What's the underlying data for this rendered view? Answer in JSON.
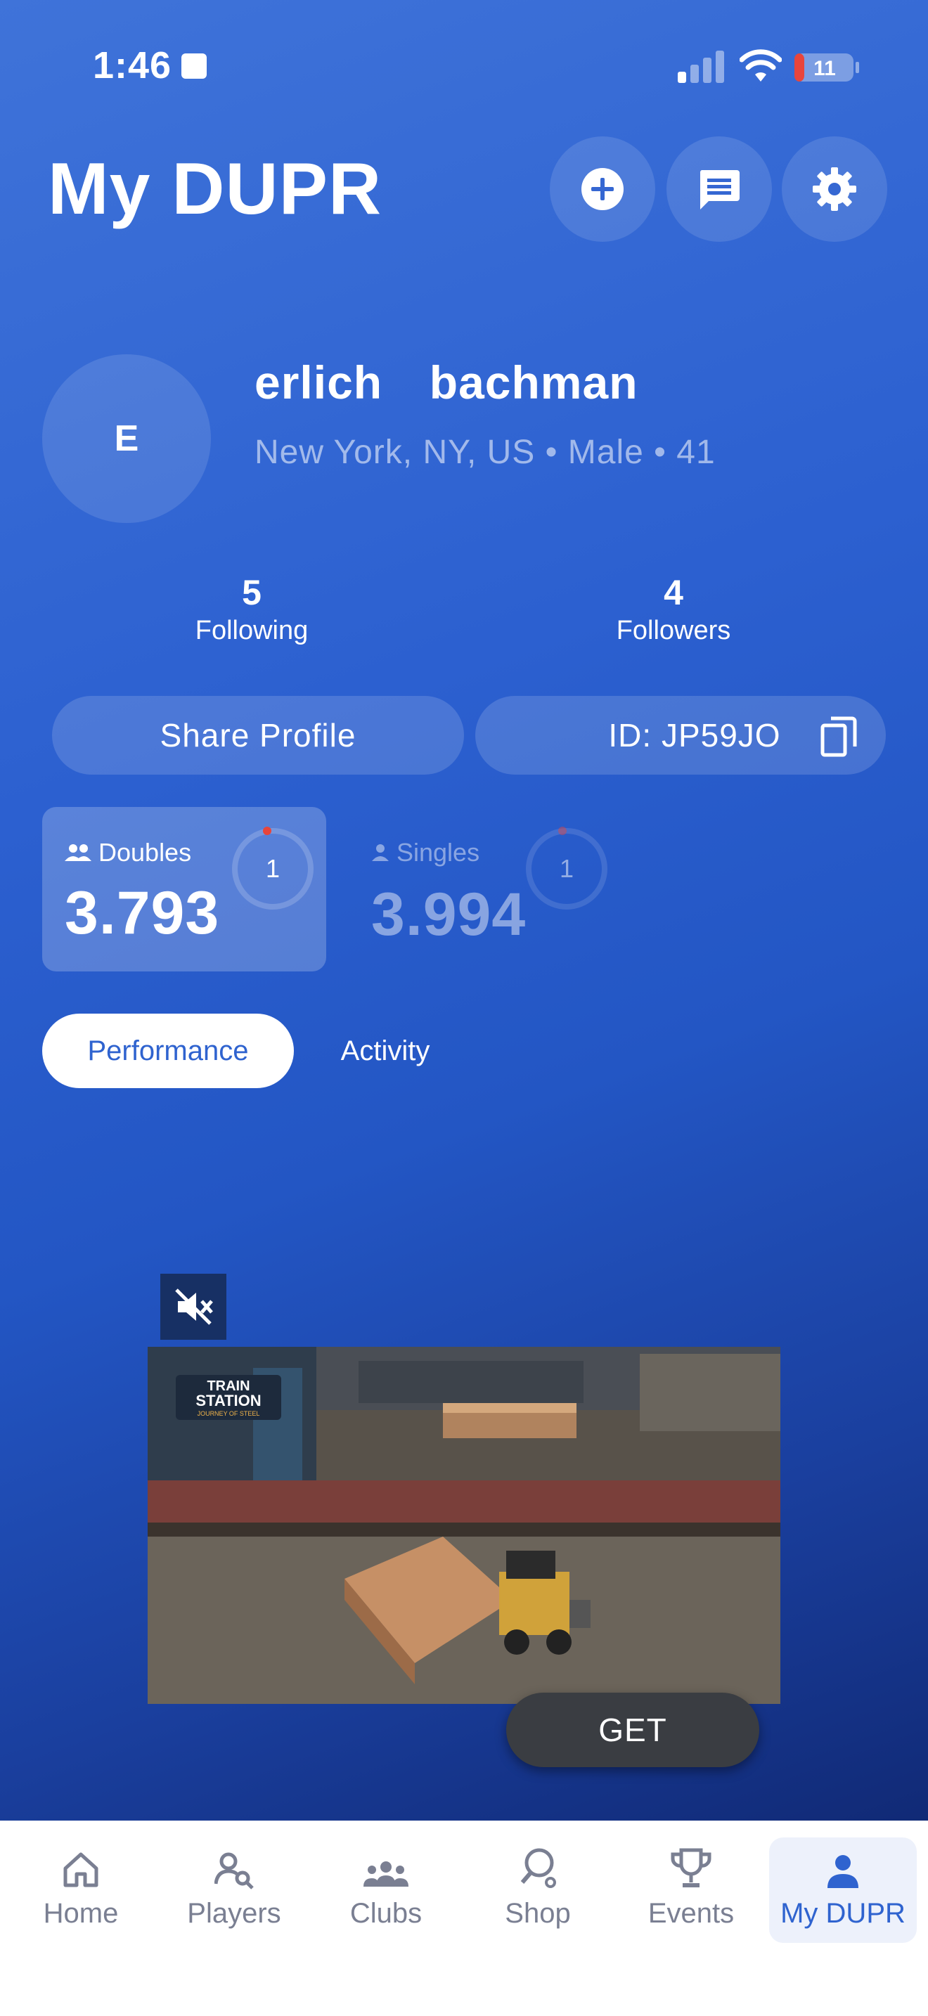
{
  "status_bar": {
    "time": "1:46",
    "battery": "11"
  },
  "header": {
    "title": "My DUPR"
  },
  "profile": {
    "avatar_initial": "E",
    "name": "erlich  bachman",
    "meta": "New York, NY, US • Male • 41"
  },
  "stats": {
    "following_count": "5",
    "following_label": "Following",
    "followers_count": "4",
    "followers_label": "Followers"
  },
  "actions": {
    "share_label": "Share Profile",
    "id_label": "ID: JP59JO"
  },
  "ratings": {
    "doubles": {
      "label": "Doubles",
      "value": "3.793",
      "badge": "1"
    },
    "singles": {
      "label": "Singles",
      "value": "3.994",
      "badge": "1"
    }
  },
  "tabs": {
    "performance": "Performance",
    "activity": "Activity"
  },
  "ad": {
    "logo_line1": "TRAIN",
    "logo_line2": "STATION",
    "logo_line3": "JOURNEY OF STEEL",
    "cta": "GET"
  },
  "nav": [
    {
      "label": "Home"
    },
    {
      "label": "Players"
    },
    {
      "label": "Clubs"
    },
    {
      "label": "Shop"
    },
    {
      "label": "Events"
    },
    {
      "label": "My DUPR"
    }
  ],
  "colors": {
    "accent": "#2f63cf",
    "battery_low": "#e8453c"
  }
}
